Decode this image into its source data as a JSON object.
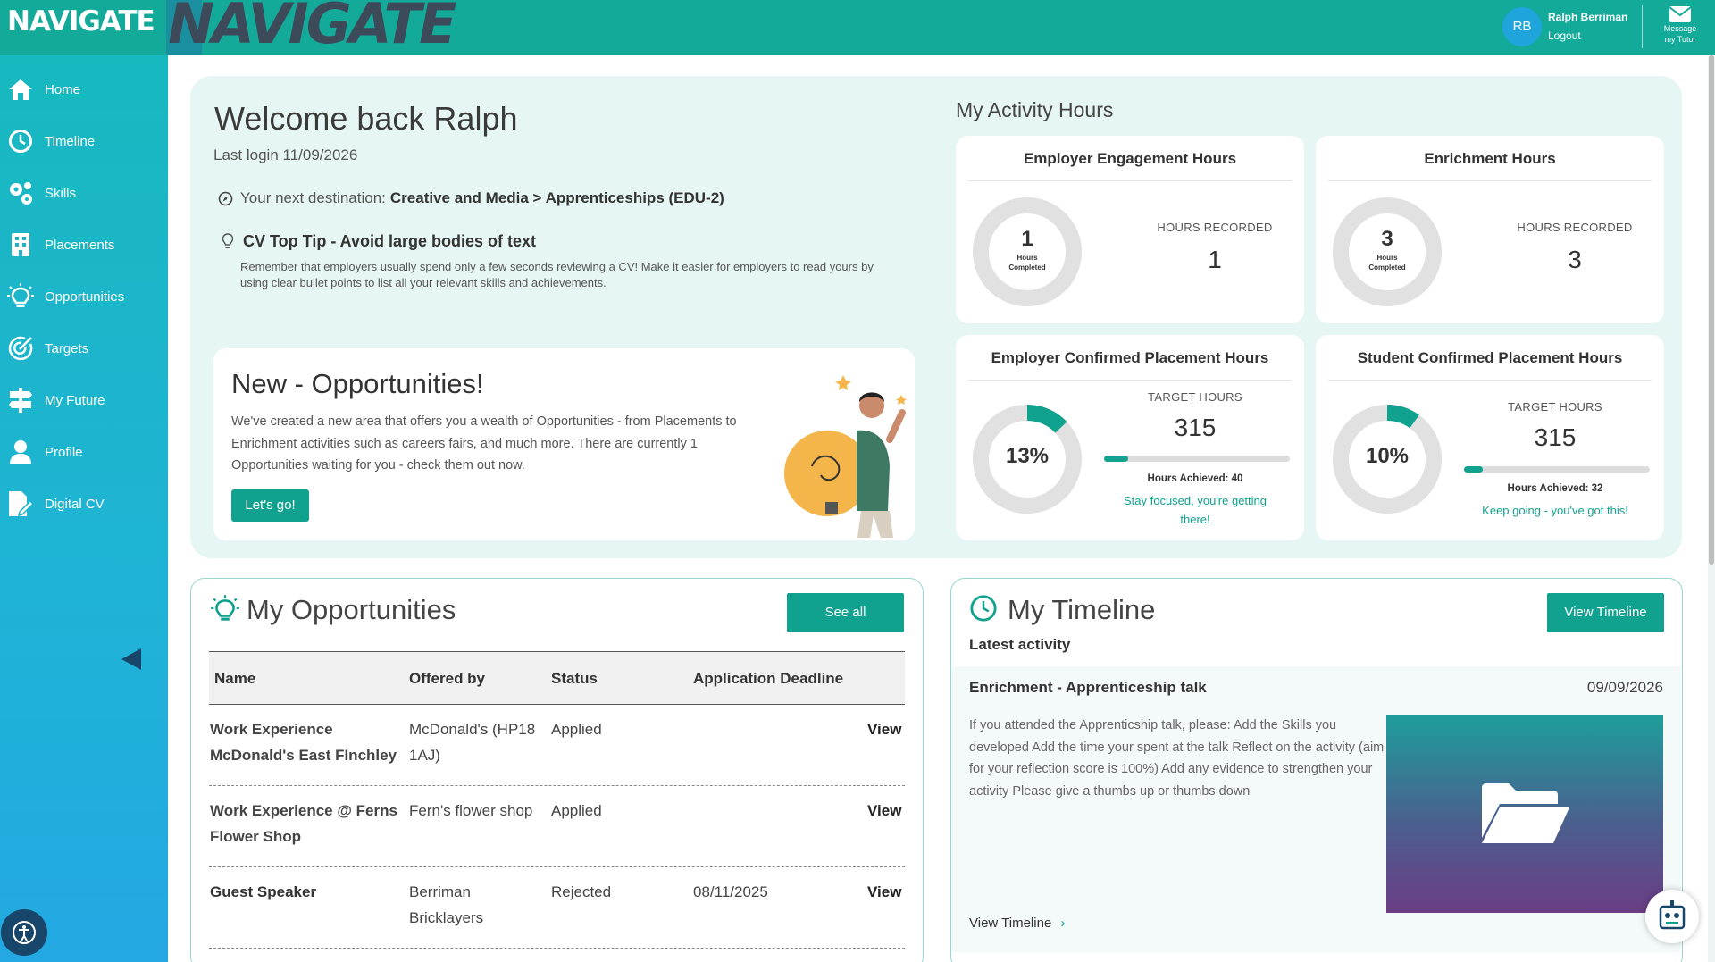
{
  "header": {
    "brand": "NAVIGATE",
    "big_brand": "NAVIGATE",
    "user": {
      "initials": "RB",
      "name": "Ralph Berriman",
      "logout": "Logout"
    },
    "message_tutor": [
      "Message",
      "my Tutor"
    ]
  },
  "sidebar": {
    "items": [
      {
        "label": "Home",
        "icon": "home-icon"
      },
      {
        "label": "Timeline",
        "icon": "clock-icon"
      },
      {
        "label": "Skills",
        "icon": "cogs-icon"
      },
      {
        "label": "Placements",
        "icon": "building-icon"
      },
      {
        "label": "Opportunities",
        "icon": "lightbulb-icon"
      },
      {
        "label": "Targets",
        "icon": "target-icon"
      },
      {
        "label": "My Future",
        "icon": "signpost-icon"
      },
      {
        "label": "Profile",
        "icon": "user-icon"
      },
      {
        "label": "Digital CV",
        "icon": "cv-edit-icon"
      }
    ]
  },
  "welcome": {
    "title": "Welcome back Ralph",
    "last_login": "Last login 11/09/2026",
    "destination_prefix": "Your next destination:",
    "destination": "Creative and Media > Apprenticeships (EDU-2)",
    "tip_title": "CV Top Tip - Avoid large bodies of text",
    "tip_body": "Remember that employers usually spend only a few seconds reviewing a CV! Make it easier for employers to read yours by using clear bullet points to list all your relevant skills and achievements."
  },
  "new_opportunities": {
    "title": "New - Opportunities!",
    "body": "We've created a new area that offers you a wealth of Opportunities - from Placements to Enrichment activities such as careers fairs, and much more. There are currently 1 Opportunities waiting for you - check them out now.",
    "button": "Let's go!"
  },
  "activity": {
    "title": "My Activity Hours",
    "employer_engagement": {
      "title": "Employer Engagement Hours",
      "donut_value": "1",
      "donut_caption_1": "Hours",
      "donut_caption_2": "Completed",
      "label": "HOURS RECORDED",
      "value": "1"
    },
    "enrichment": {
      "title": "Enrichment Hours",
      "donut_value": "3",
      "donut_caption_1": "Hours",
      "donut_caption_2": "Completed",
      "label": "HOURS RECORDED",
      "value": "3"
    },
    "employer_confirmed": {
      "title": "Employer Confirmed Placement Hours",
      "percent_label": "13%",
      "progress": 0.13,
      "label": "TARGET HOURS",
      "value": "315",
      "achieved": "Hours Achieved: 40",
      "encouragement": "Stay focused, you're getting there!"
    },
    "student_confirmed": {
      "title": "Student Confirmed Placement Hours",
      "percent_label": "10%",
      "progress": 0.1,
      "label": "TARGET HOURS",
      "value": "315",
      "achieved": "Hours Achieved: 32",
      "encouragement": "Keep going - you've got this!"
    }
  },
  "opportunities_panel": {
    "title": "My Opportunities",
    "see_all": "See all",
    "columns": [
      "Name",
      "Offered by",
      "Status",
      "Application Deadline"
    ],
    "rows": [
      {
        "name_1": "Work Experience",
        "name_2": "McDonald's East FInchley",
        "offered_1": "McDonald's (HP18",
        "offered_2": "1AJ)",
        "status": "Applied",
        "deadline": "",
        "action": "View"
      },
      {
        "name_1": "Work Experience @ Ferns",
        "name_2": "Flower Shop",
        "offered_1": "Fern's flower shop",
        "offered_2": "",
        "status": "Applied",
        "deadline": "",
        "action": "View"
      },
      {
        "name_1": "Guest Speaker",
        "name_2": "",
        "offered_1": "Berriman",
        "offered_2": "Bricklayers",
        "status": "Rejected",
        "deadline": "08/11/2025",
        "action": "View"
      }
    ]
  },
  "timeline_panel": {
    "title": "My Timeline",
    "view_button": "View Timeline",
    "latest": "Latest activity",
    "entry_title": "Enrichment - Apprenticeship talk",
    "entry_date": "09/09/2026",
    "entry_desc": "If you attended the Apprenticship talk, please: Add the Skills you developed Add the time your spent at the talk Reflect on the activity (aim for your reflection score is 100%) Add any evidence to strengthen your activity Please give a thumbs up or thumbs down",
    "link": "View Timeline"
  },
  "colors": {
    "accent": "#11a28f",
    "topbar": "#13aa9a",
    "navy": "#17466a"
  }
}
